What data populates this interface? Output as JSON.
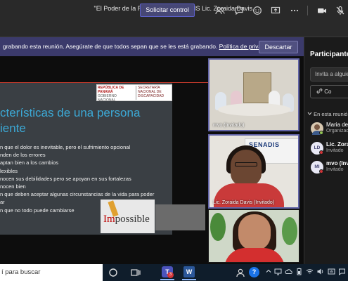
{
  "window": {
    "title": "\"El Poder de la Resiliencia\" SENADIS Lic. Zoraida Davis."
  },
  "toolbar": {
    "share_label": "Solicitar control",
    "icons": [
      "people-icon",
      "chat-icon",
      "reactions-icon",
      "share-tray-icon",
      "more-icon",
      "camera-icon",
      "mic-off-icon"
    ]
  },
  "banner": {
    "text": "grabando esta reunión. Asegúrate de que todos sepan que se les está grabando.",
    "link": "Política de privacidad",
    "dismiss_label": "Descartar"
  },
  "slide": {
    "logo_left": "REPÚBLICA DE PANAMÁ",
    "logo_left_sub": "GOBIERNO NACIONAL",
    "logo_right": "SECRETARÍA NACIONAL DE DISCAPACIDAD",
    "title_line1": "cterísticas de una persona",
    "title_line2": "iente",
    "bullets": [
      "n que el dolor es inevitable, pero el sufrimiento opcional",
      "nden de los errores",
      "aptan bien a los cambios",
      "lexibles",
      "nocen sus debilidades pero se apoyan en sus fortalezas",
      "nocen bien",
      "n que deben aceptar algunas circunstancias de la vida para poder",
      "ar",
      "n que no todo puede cambiarse"
    ],
    "image_word": "possible",
    "image_prefix": "Im"
  },
  "tiles": [
    {
      "label": "mvo (Invitado)"
    },
    {
      "label": "Lic. Zoraida Davis (Invitado)",
      "banner_text": "SENADIS"
    },
    {
      "label": ""
    }
  ],
  "panel": {
    "title": "Participantes",
    "invite_placeholder": "Invita a alguien",
    "share_label": "Co",
    "section_label": "En esta reunión (3)",
    "people": [
      {
        "name": "Maria del",
        "role": "Organizador",
        "initials": "",
        "bold": false
      },
      {
        "name": "Lic. Zorai",
        "role": "Invitado",
        "initials": "LD",
        "bold": true
      },
      {
        "name": "mvo (Invi",
        "role": "Invitado",
        "initials": "MI",
        "bold": true
      }
    ]
  },
  "taskbar": {
    "search_placeholder": "í para buscar",
    "teams_badge": "3",
    "word_letter": "W",
    "teams_letter": "T",
    "help_symbol": "?"
  }
}
